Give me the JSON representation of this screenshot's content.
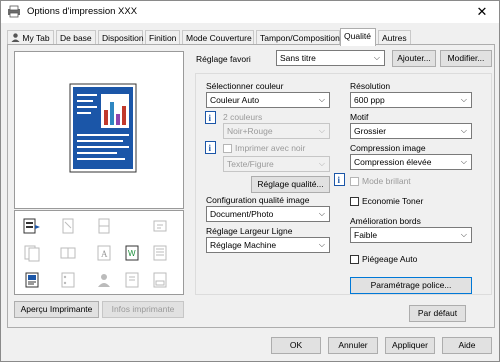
{
  "window": {
    "title": "Options d'impression XXX",
    "close": "✕"
  },
  "tabs": [
    "My Tab",
    "De base",
    "Disposition",
    "Finition",
    "Mode Couverture",
    "Tampon/Composition",
    "Qualité",
    "Autres"
  ],
  "active_tab": "Qualité",
  "favorite": {
    "label": "Réglage favori",
    "value": "Sans titre",
    "add_button": "Ajouter...",
    "modify_button": "Modifier..."
  },
  "color": {
    "label": "Sélectionner couleur",
    "value": "Couleur Auto",
    "two_colors_label": "2 couleurs",
    "two_colors_value": "Noir+Rouge",
    "print_black_label": "Imprimer avec noir",
    "print_black_value": "Texte/Figure",
    "quality_button": "Réglage qualité..."
  },
  "image_config": {
    "label": "Configuration qualité image",
    "value": "Document/Photo"
  },
  "line_width": {
    "label": "Réglage Largeur Ligne",
    "value": "Réglage Machine"
  },
  "resolution": {
    "label": "Résolution",
    "value": "600 ppp"
  },
  "pattern": {
    "label": "Motif",
    "value": "Grossier"
  },
  "compression": {
    "label": "Compression image",
    "value": "Compression élevée"
  },
  "glossy": {
    "label": "Mode brillant"
  },
  "toner_save": {
    "label": "Economie Toner"
  },
  "edge": {
    "label": "Amélioration bords",
    "value": "Faible"
  },
  "trapping": {
    "label": "Piégeage Auto"
  },
  "font_settings_button": "Paramétrage police...",
  "default_button": "Par défaut",
  "preview_buttons": {
    "printer": "Aperçu Imprimante",
    "info": "Infos imprimante"
  },
  "footer": {
    "ok": "OK",
    "cancel": "Annuler",
    "apply": "Appliquer",
    "help": "Aide"
  },
  "colors": {
    "accent": "#0078d7",
    "page_blue": "#1b56a8",
    "page_bar_red": "#c0392b"
  }
}
